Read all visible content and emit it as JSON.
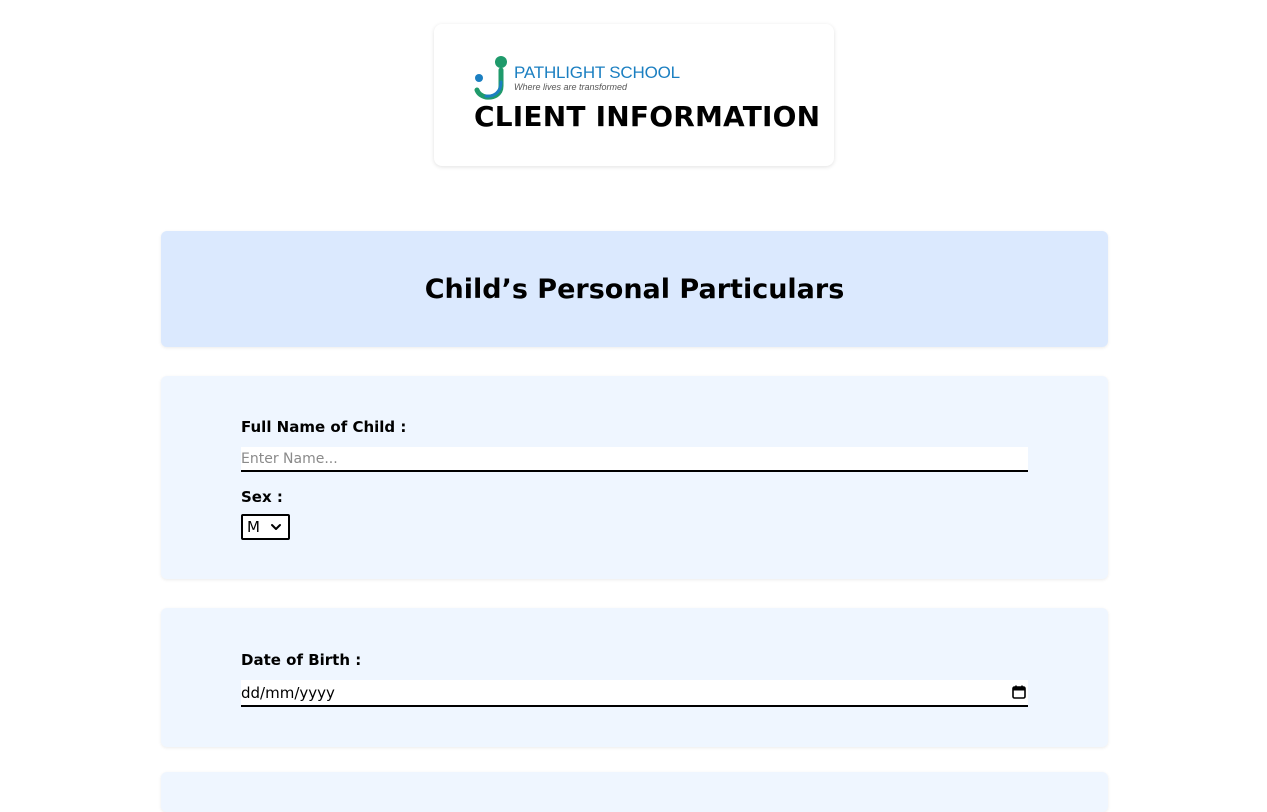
{
  "header": {
    "logo_name": "PATHLIGHT SCHOOL",
    "logo_tagline": "Where lives are transformed",
    "title": "CLIENT INFORMATION"
  },
  "section": {
    "title": "Child’s Personal Particulars"
  },
  "form": {
    "full_name": {
      "label": "Full Name of Child :",
      "placeholder": "Enter Name...",
      "value": ""
    },
    "sex": {
      "label": "Sex :",
      "selected": "M"
    },
    "dob": {
      "label": "Date of Birth :",
      "value": "dd/mm/yyyy"
    }
  },
  "colors": {
    "banner": "#dbe9fe",
    "card": "#eff6ff",
    "logo_blue": "#1b7fc1",
    "logo_green": "#1f9a6b"
  },
  "icons": {
    "logo": "pathlight-logo-icon",
    "select": "chevron-down-icon",
    "date": "calendar-icon"
  }
}
